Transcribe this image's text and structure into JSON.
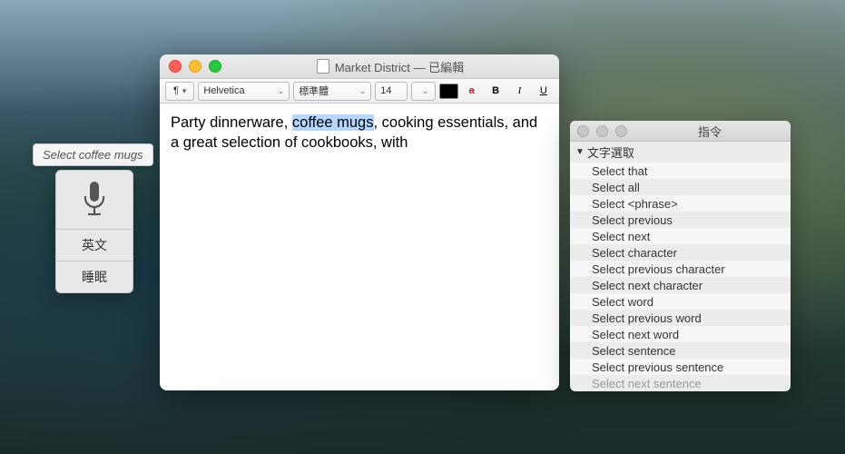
{
  "textedit": {
    "title": "Market District — 已編輯",
    "toolbar": {
      "paragraph": "¶",
      "font": "Helvetica",
      "style": "標準體",
      "size": "14"
    },
    "body": {
      "pre": "Party dinnerware, ",
      "selected": "coffee mugs",
      "post": ", cooking essentials, and a great selection of cookbooks, with"
    }
  },
  "voice": {
    "feedback": "Select coffee mugs",
    "language": "英文",
    "state": "睡眠"
  },
  "commands": {
    "title": "指令",
    "section": "文字選取",
    "items": [
      "Select that",
      "Select all",
      "Select <phrase>",
      "Select previous",
      "Select next",
      "Select character",
      "Select previous character",
      "Select next character",
      "Select word",
      "Select previous word",
      "Select next word",
      "Select sentence",
      "Select previous sentence",
      "Select next sentence"
    ]
  }
}
